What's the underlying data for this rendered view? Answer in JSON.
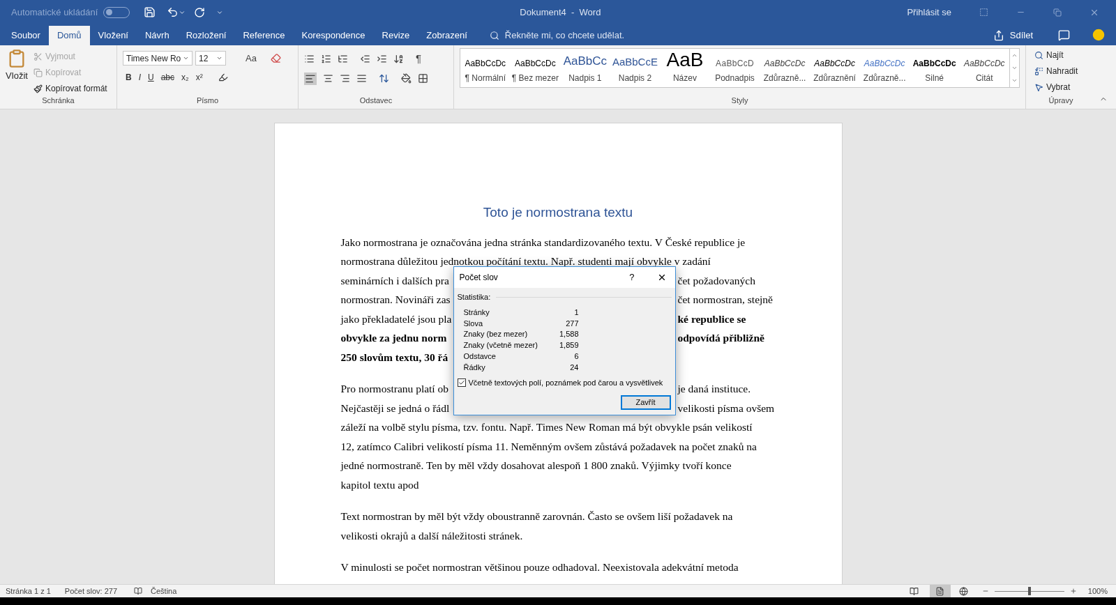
{
  "title_bar": {
    "autosave": {
      "label": "Automatické ukládání",
      "on": false
    },
    "title": "Dokument4  -  Word",
    "sign_in": "Přihlásit se"
  },
  "tabs": [
    {
      "label": "Soubor",
      "selected": false
    },
    {
      "label": "Domů",
      "selected": true
    },
    {
      "label": "Vložení",
      "selected": false
    },
    {
      "label": "Návrh",
      "selected": false
    },
    {
      "label": "Rozložení",
      "selected": false
    },
    {
      "label": "Reference",
      "selected": false
    },
    {
      "label": "Korespondence",
      "selected": false
    },
    {
      "label": "Revize",
      "selected": false
    },
    {
      "label": "Zobrazení",
      "selected": false
    }
  ],
  "tell_me": {
    "placeholder": "Řekněte mi, co chcete udělat."
  },
  "share": "Sdílet",
  "clipboard": {
    "title": "Schránka",
    "paste": "Vložit",
    "items": [
      {
        "label": "Vyjmout",
        "disabled": true
      },
      {
        "label": "Kopírovat",
        "disabled": true
      },
      {
        "label": "Kopírovat formát",
        "disabled": false
      }
    ]
  },
  "font": {
    "title": "Písmo",
    "name": "Times New Ro",
    "size": "12",
    "case": "Aa",
    "format": [
      "B",
      "I",
      "U",
      "abc",
      "x₂",
      "x²"
    ]
  },
  "paragraph": {
    "title": "Odstavec",
    "pilcrow": "¶"
  },
  "styles": {
    "title": "Styly",
    "items": [
      {
        "preview": "AaBbCcDc",
        "name": "¶ Normální",
        "kind": "normal"
      },
      {
        "preview": "AaBbCcDc",
        "name": "¶ Bez mezer",
        "kind": "normal"
      },
      {
        "preview": "AaBbCc",
        "name": "Nadpis 1",
        "kind": "heading1"
      },
      {
        "preview": "AaBbCcE",
        "name": "Nadpis 2",
        "kind": "heading2"
      },
      {
        "preview": "AaB",
        "name": "Název",
        "kind": "title"
      },
      {
        "preview": "AaBbCcD",
        "name": "Podnadpis",
        "kind": "subtitle"
      },
      {
        "preview": "AaBbCcDc",
        "name": "Zdůrazně...",
        "kind": "emphasis"
      },
      {
        "preview": "AaBbCcDc",
        "name": "Zdůraznění",
        "kind": "emphasis_strong"
      },
      {
        "preview": "AaBbCcDc",
        "name": "Zdůrazně...",
        "kind": "emphasis_blue"
      },
      {
        "preview": "AaBbCcDc",
        "name": "Silné",
        "kind": "strong"
      },
      {
        "preview": "AaBbCcDc",
        "name": "Citát",
        "kind": "quote"
      }
    ]
  },
  "editing": {
    "title": "Úpravy",
    "items": [
      "Najít",
      "Nahradit",
      "Vybrat"
    ]
  },
  "document": {
    "heading": "Toto je normostrana textu",
    "paragraphs": [
      {
        "lines": [
          {
            "left": {
              "text": "Jako normostrana je označována jedna stránka standardizovaného textu. V České republice je",
              "bold": false
            }
          },
          {
            "left": {
              "text": "normostrana důležitou jednotkou počítání textu. Např. studenti mají obvykle v zadání",
              "bold": false
            }
          },
          {
            "left": {
              "text": "seminárních i dalších pra",
              "bold": false
            },
            "right": {
              "text": "čet požadovaných",
              "bold": false
            }
          },
          {
            "left": {
              "text": "normostran. Novináři zas",
              "bold": false
            },
            "right": {
              "text": "čet normostran, stejně",
              "bold": false
            }
          },
          {
            "left": {
              "text": "jako překladatelé jsou pla",
              "bold": false
            },
            "right": {
              "text": "ké republice se",
              "bold": true
            }
          },
          {
            "left": {
              "text": "obvykle za jednu norm",
              "bold": true
            },
            "right": {
              "text": "odpovídá přibližně",
              "bold": true
            }
          },
          {
            "left": {
              "text": "250 slovům textu, 30 řá",
              "bold": true
            }
          }
        ]
      },
      {
        "lines": [
          {
            "left": {
              "text": "Pro normostranu platí ob",
              "bold": false
            },
            "right": {
              "text": "je daná instituce.",
              "bold": false
            }
          },
          {
            "left": {
              "text": "Nejčastěji se jedná o řádl",
              "bold": false
            },
            "right": {
              "text": "velikosti písma ovšem",
              "bold": false
            }
          },
          {
            "left": {
              "text": "záleží na volbě stylu písma, tzv. fontu. Např. Times New Roman má být obvykle psán velikostí",
              "bold": false
            }
          },
          {
            "left": {
              "text": "12, zatímco Calibri velikostí písma 11. Neměnným ovšem zůstává požadavek na počet znaků na",
              "bold": false
            }
          },
          {
            "left": {
              "text": "jedné normostraně. Ten by měl vždy dosahovat alespoň 1 800 znaků. Výjimky tvoří konce",
              "bold": false
            }
          },
          {
            "left": {
              "text": "kapitol textu apod",
              "bold": false
            }
          }
        ]
      },
      {
        "lines": [
          {
            "left": {
              "text": "Text normostran by měl být vždy oboustranně zarovnán. Často se ovšem liší požadavek na",
              "bold": false
            }
          },
          {
            "left": {
              "text": "velikosti okrajů a další náležitosti stránek.",
              "bold": false
            }
          }
        ]
      },
      {
        "lines": [
          {
            "left": {
              "text": "V minulosti se počet normostran většinou pouze odhadoval. Neexistovala adekvátní metoda",
              "bold": false
            }
          }
        ]
      }
    ]
  },
  "dialog": {
    "title": "Počet slov",
    "help": "?",
    "section": "Statistika:",
    "stats": [
      {
        "label": "Stránky",
        "value": "1"
      },
      {
        "label": "Slova",
        "value": "277"
      },
      {
        "label": "Znaky (bez mezer)",
        "value": "1,588"
      },
      {
        "label": "Znaky (včetně mezer)",
        "value": "1,859"
      },
      {
        "label": "Odstavce",
        "value": "6"
      },
      {
        "label": "Řádky",
        "value": "24"
      }
    ],
    "checkbox": {
      "label": "Včetně textových polí, poznámek pod čarou a vysvětlivek",
      "checked": true
    },
    "button": "Zavřít"
  },
  "status_bar": {
    "page": "Stránka 1 z 1",
    "words": "Počet slov: 277",
    "language": "Čeština",
    "zoom": {
      "level": 0.5,
      "reading": "100%"
    }
  }
}
